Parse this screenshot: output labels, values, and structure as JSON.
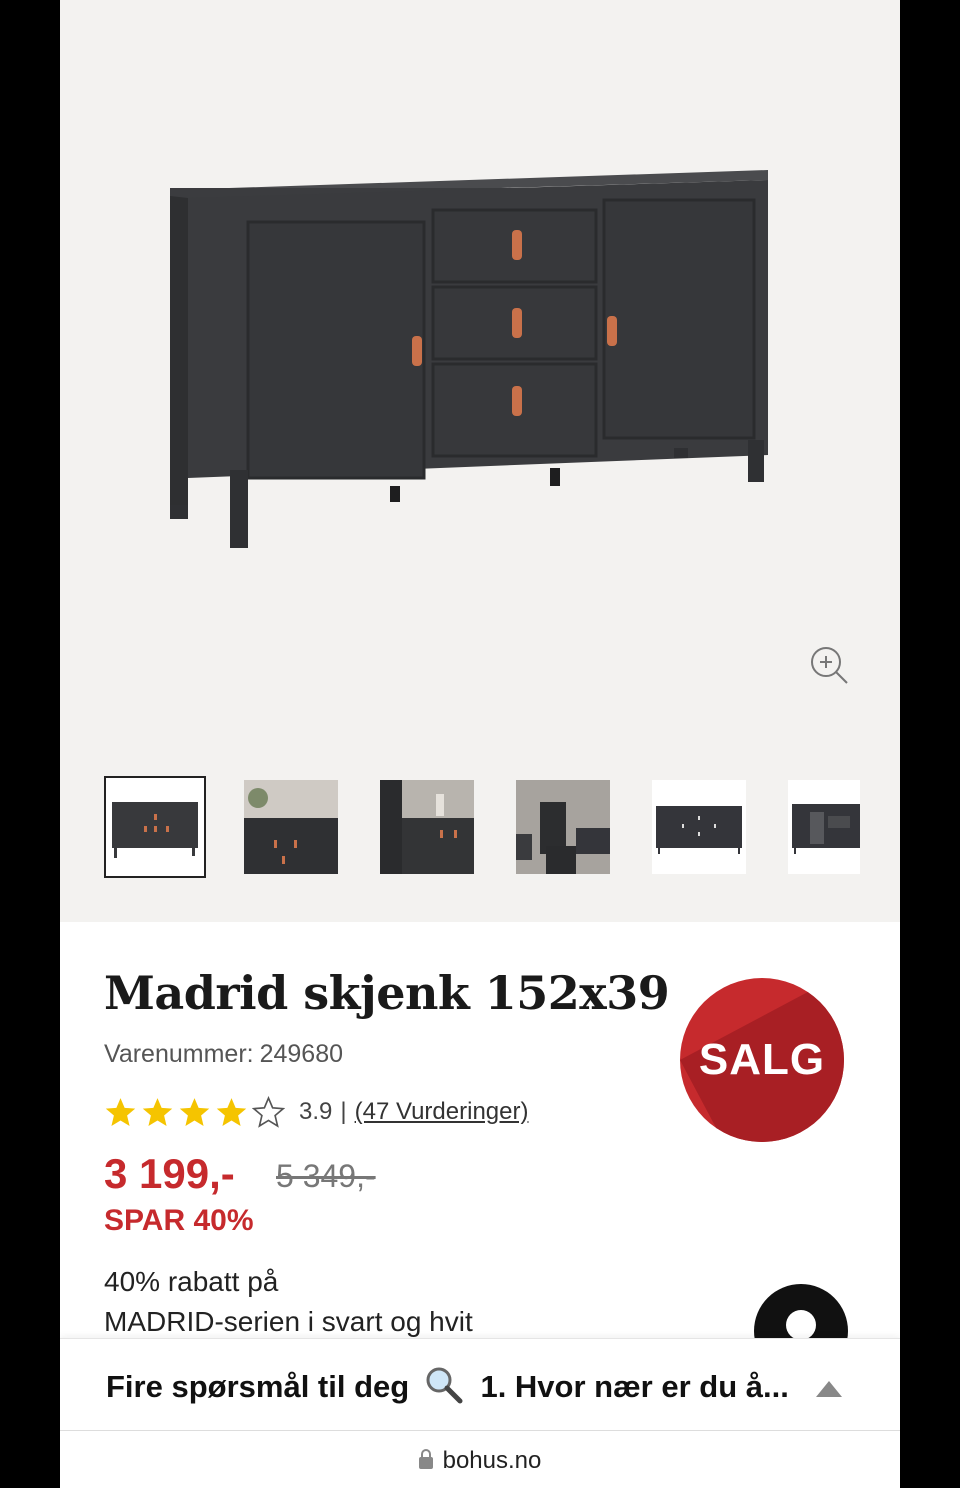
{
  "product": {
    "title": "Madrid skjenk 152x39",
    "sku_label": "Varenummer:",
    "sku": "249680",
    "badge": "SALG",
    "rating": {
      "stars": 3.9,
      "value": "3.9",
      "separator": "|",
      "reviews_label": "(47 Vurderinger)"
    },
    "price": "3 199,-",
    "old_price": "5 349,-",
    "savings": "SPAR 40%",
    "promo_line1": "40% rabatt på",
    "promo_line2": "MADRID-serien i svart og hvit"
  },
  "gallery": {
    "thumbnail_count": 6,
    "active_index": 0
  },
  "banner": {
    "text_before": "Fire spørsmål til deg",
    "text_after": "1. Hvor nær er du å..."
  },
  "browser": {
    "url": "bohus.no"
  },
  "colors": {
    "sale_red": "#c62a2d",
    "star_yellow": "#f5c400",
    "furniture": "#3a3b3e",
    "leather": "#c9714a",
    "gallery_bg": "#f3f2f0"
  }
}
